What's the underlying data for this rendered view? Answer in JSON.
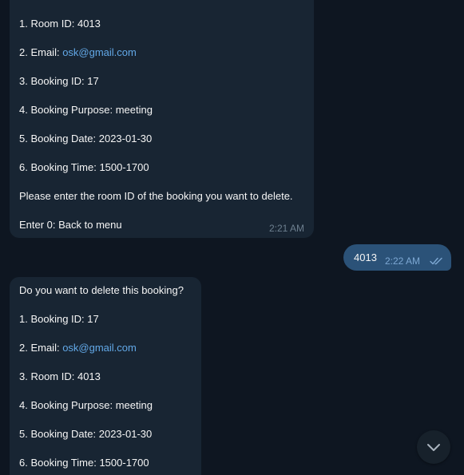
{
  "messages": {
    "first": {
      "lines": [
        {
          "prefix": "1. Room ID: ",
          "value": "4013"
        },
        {
          "prefix": "2. Email: ",
          "link": "osk@gmail.com"
        },
        {
          "prefix": "3. Booking ID: ",
          "value": "17"
        },
        {
          "prefix": "4. Booking Purpose: ",
          "value": "meeting"
        },
        {
          "prefix": "5. Booking Date: ",
          "value": "2023-01-30"
        },
        {
          "prefix": "6. Booking Time: ",
          "value": "1500-1700"
        }
      ],
      "prompt": "Please enter the room ID of the booking you want to delete.",
      "back": "Enter 0: Back to menu",
      "time": "2:21 AM"
    },
    "reply": {
      "text": "4013",
      "time": "2:22 AM"
    },
    "second": {
      "question": "Do you want to delete this booking?",
      "lines": [
        {
          "prefix": "1. Booking ID: ",
          "value": "17"
        },
        {
          "prefix": "2. Email: ",
          "link": "osk@gmail.com"
        },
        {
          "prefix": "3. Room ID: ",
          "value": "4013"
        },
        {
          "prefix": "4. Booking Purpose: ",
          "value": "meeting"
        },
        {
          "prefix": "5. Booking Date: ",
          "value": "2023-01-30"
        },
        {
          "prefix": "6. Booking Time: ",
          "value": "1500-1700"
        }
      ]
    }
  },
  "icons": {
    "read_checks": "double-check-icon",
    "scroll_down": "chevron-down-icon"
  },
  "colors": {
    "background": "#0e1621",
    "incoming_bubble": "#182533",
    "outgoing_bubble": "#2b5278",
    "link": "#62a8e7"
  }
}
